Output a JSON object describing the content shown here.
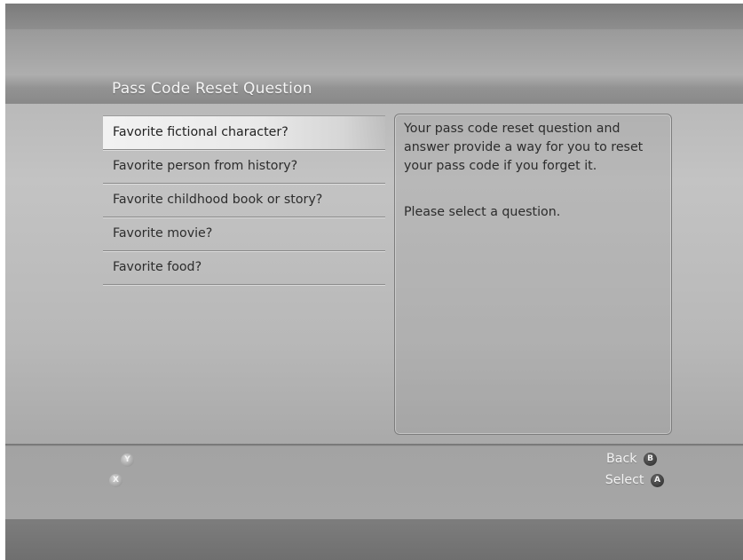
{
  "header": {
    "title": "Pass Code Reset Question"
  },
  "questions": [
    {
      "label": "Favorite fictional character?",
      "selected": true
    },
    {
      "label": "Favorite person from history?",
      "selected": false
    },
    {
      "label": "Favorite childhood book or story?",
      "selected": false
    },
    {
      "label": "Favorite movie?",
      "selected": false
    },
    {
      "label": "Favorite food?",
      "selected": false
    }
  ],
  "info": {
    "description": "Your pass code reset question and answer provide a way for you to reset your pass code if you forget it.",
    "prompt": "Please select a question."
  },
  "footer": {
    "y_button": "Y",
    "x_button": "X",
    "back_label": "Back",
    "back_button": "B",
    "select_label": "Select",
    "select_button": "A"
  },
  "icons": {
    "y_button": "y-button-icon",
    "x_button": "x-button-icon",
    "b_button": "b-button-icon",
    "a_button": "a-button-icon"
  },
  "colors": {
    "title_text": "#f4f4f4",
    "item_text": "#2c2c2c",
    "selected_highlight": "#f2f2f2"
  }
}
